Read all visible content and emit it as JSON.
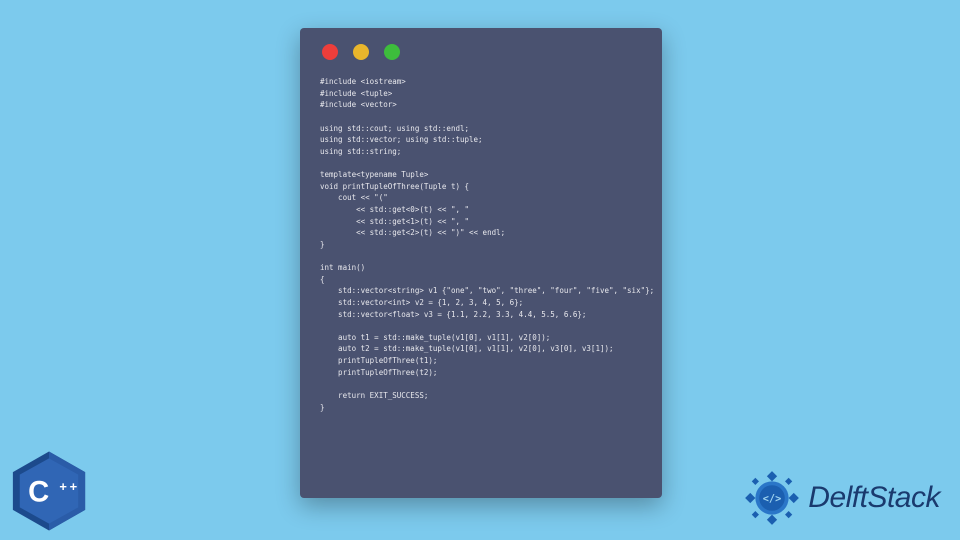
{
  "window": {
    "code": "#include <iostream>\n#include <tuple>\n#include <vector>\n\nusing std::cout; using std::endl;\nusing std::vector; using std::tuple;\nusing std::string;\n\ntemplate<typename Tuple>\nvoid printTupleOfThree(Tuple t) {\n    cout << \"(\" \n        << std::get<0>(t) << \", \"\n        << std::get<1>(t) << \", \"\n        << std::get<2>(t) << \")\" << endl;\n}\n\nint main()\n{\n    std::vector<string> v1 {\"one\", \"two\", \"three\", \"four\", \"five\", \"six\"};\n    std::vector<int> v2 = {1, 2, 3, 4, 5, 6};\n    std::vector<float> v3 = {1.1, 2.2, 3.3, 4.4, 5.5, 6.6};\n\n    auto t1 = std::make_tuple(v1[0], v1[1], v2[0]);\n    auto t2 = std::make_tuple(v1[0], v1[1], v2[0], v3[0], v3[1]);\n    printTupleOfThree(t1);\n    printTupleOfThree(t2);\n\n    return EXIT_SUCCESS;\n}"
  },
  "logo": {
    "text": "DelftStack"
  },
  "cpp": {
    "label": "C++"
  }
}
